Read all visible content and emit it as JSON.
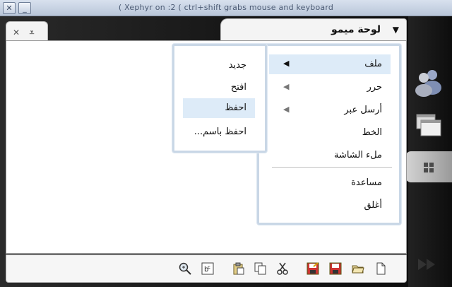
{
  "window": {
    "title": "( Xephyr on :2 ( ctrl+shift grabs mouse and keyboard"
  },
  "app_tab": {
    "title": "لوحة ميمو",
    "menu_arrow": "▼"
  },
  "main_menu": {
    "items": [
      {
        "label": "ملف",
        "has_submenu": true,
        "active": true
      },
      {
        "label": "حرر",
        "has_submenu": true
      },
      {
        "label": "أرسل عبر",
        "has_submenu": true
      },
      {
        "label": "الخط"
      },
      {
        "label": "ملء الشاشة"
      },
      {
        "label": "مساعدة"
      },
      {
        "label": "أغلق"
      }
    ]
  },
  "file_submenu": {
    "items": [
      {
        "label": "جديد"
      },
      {
        "label": "افتح"
      },
      {
        "label": "احفظ",
        "active": true
      },
      {
        "label": "احفظ باسم..."
      }
    ]
  },
  "toolbar": {
    "tools": [
      "new-document-icon",
      "open-folder-icon",
      "save-icon",
      "save-as-icon",
      "cut-icon",
      "copy-icon",
      "paste-icon",
      "font-icon",
      "zoom-icon"
    ]
  },
  "dock": {
    "items": [
      "users-icon",
      "windows-icon",
      "grid-icon"
    ]
  }
}
